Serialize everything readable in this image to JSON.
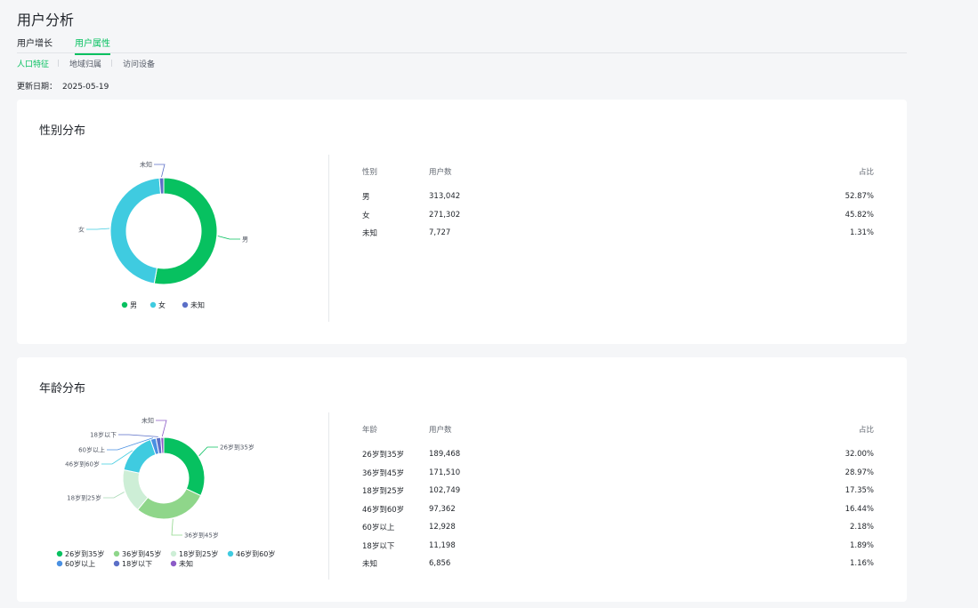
{
  "page_title": "用户分析",
  "tabs": [
    "用户增长",
    "用户属性"
  ],
  "subtabs": [
    "人口特征",
    "地域归属",
    "访问设备"
  ],
  "update": {
    "label": "更新日期：",
    "value": "2025-05-19"
  },
  "gender": {
    "title": "性别分布",
    "headers": [
      "性别",
      "用户数",
      "占比"
    ],
    "rows": [
      [
        "男",
        "313,042",
        "52.87%"
      ],
      [
        "女",
        "271,302",
        "45.82%"
      ],
      [
        "未知",
        "7,727",
        "1.31%"
      ]
    ]
  },
  "age": {
    "title": "年龄分布",
    "headers": [
      "年龄",
      "用户数",
      "占比"
    ],
    "rows": [
      [
        "26岁到35岁",
        "189,468",
        "32.00%"
      ],
      [
        "36岁到45岁",
        "171,510",
        "28.97%"
      ],
      [
        "18岁到25岁",
        "102,749",
        "17.35%"
      ],
      [
        "46岁到60岁",
        "97,362",
        "16.44%"
      ],
      [
        "60岁以上",
        "12,928",
        "2.18%"
      ],
      [
        "18岁以下",
        "11,198",
        "1.89%"
      ],
      [
        "未知",
        "6,856",
        "1.16%"
      ]
    ]
  },
  "chart_data": [
    {
      "type": "pie",
      "title": "性别分布",
      "categories": [
        "男",
        "女",
        "未知"
      ],
      "values": [
        52.87,
        45.82,
        1.31
      ],
      "colors": [
        "#07c160",
        "#3fcbe0",
        "#5b6fc7"
      ],
      "legend": "bottom"
    },
    {
      "type": "pie",
      "title": "年龄分布",
      "categories": [
        "26岁到35岁",
        "36岁到45岁",
        "18岁到25岁",
        "46岁到60岁",
        "60岁以上",
        "18岁以下",
        "未知"
      ],
      "values": [
        32.0,
        28.97,
        17.35,
        16.44,
        2.18,
        1.89,
        1.16
      ],
      "colors": [
        "#07c160",
        "#8fd68a",
        "#cdeed6",
        "#3fcbe0",
        "#4a90e2",
        "#5b6fc7",
        "#8c5bc7"
      ],
      "legend": "bottom"
    }
  ]
}
